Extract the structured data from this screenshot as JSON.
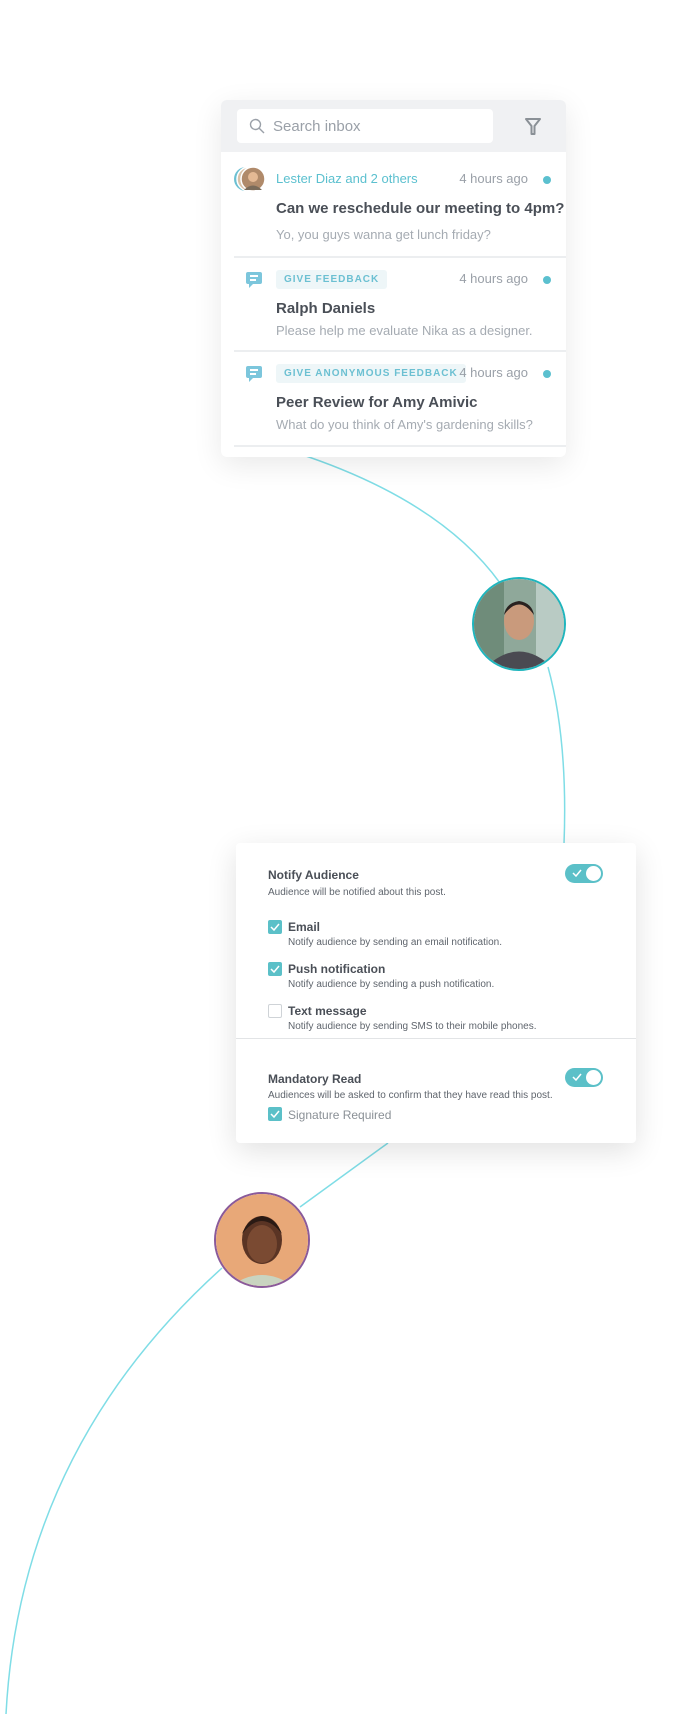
{
  "colors": {
    "accent": "#5bc0c8",
    "curve": "#7fdde6",
    "avatar_ring_1": "#1fb5bd",
    "avatar_ring_2": "#8a5a9a"
  },
  "inbox": {
    "search_placeholder": "Search inbox",
    "filter_icon": "filter-icon",
    "messages": [
      {
        "sender": "Lester Diaz and 2 others",
        "time": "4 hours ago",
        "title": "Can we reschedule our meeting to 4pm?",
        "preview": "Yo, you guys wanna get lunch friday?",
        "unread": true
      },
      {
        "tag": "GIVE FEEDBACK",
        "time": "4 hours ago",
        "title": "Ralph Daniels",
        "preview": "Please help me evaluate Nika as a designer.",
        "unread": true
      },
      {
        "tag": "GIVE ANONYMOUS FEEDBACK",
        "time": "4 hours ago",
        "title": "Peer Review for Amy Amivic",
        "preview": "What do you think of Amy's gardening skills?",
        "unread": true
      }
    ]
  },
  "settings": {
    "notify": {
      "title": "Notify Audience",
      "subtitle": "Audience will be notified about this post.",
      "enabled": true,
      "options": [
        {
          "label": "Email",
          "desc": "Notify audience by sending an email notification.",
          "checked": true
        },
        {
          "label": "Push notification",
          "desc": "Notify audience by sending a push notification.",
          "checked": true
        },
        {
          "label": "Text message",
          "desc": "Notify audience by sending SMS to their mobile phones.",
          "checked": false
        }
      ]
    },
    "mandatory": {
      "title": "Mandatory Read",
      "subtitle": "Audiences will be asked to confirm that they have read this post.",
      "enabled": true,
      "signature_label": "Signature Required",
      "signature_checked": true
    }
  }
}
